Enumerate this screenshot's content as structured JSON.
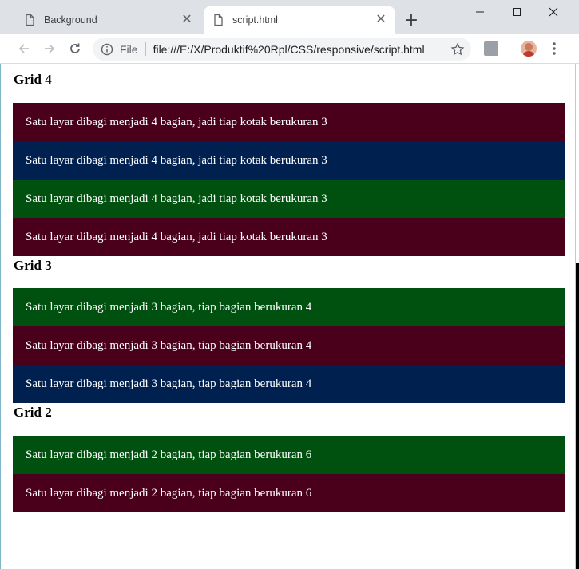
{
  "browser": {
    "tabs": [
      {
        "title": "Background",
        "active": false
      },
      {
        "title": "script.html",
        "active": true
      }
    ],
    "omnibox": {
      "scheme_label": "File",
      "url": "file:///E:/X/Produktif%20Rpl/CSS/responsive/script.html"
    },
    "icons": {
      "back": "arrow-left-icon",
      "forward": "arrow-right-icon",
      "reload": "reload-icon",
      "info": "info-icon",
      "star": "star-icon",
      "menu": "kebab-menu-icon",
      "new_tab": "plus-icon",
      "minimize": "minimize-icon",
      "maximize": "maximize-icon",
      "close": "close-icon"
    }
  },
  "colors": {
    "maroon": "#4a001a",
    "navy": "#002150",
    "green": "#00500f"
  },
  "sections": [
    {
      "heading": "Grid 4",
      "boxes": [
        {
          "text": "Satu layar dibagi menjadi 4 bagian, jadi tiap kotak berukuran 3",
          "color": "#4a001a"
        },
        {
          "text": "Satu layar dibagi menjadi 4 bagian, jadi tiap kotak berukuran 3",
          "color": "#002150"
        },
        {
          "text": "Satu layar dibagi menjadi 4 bagian, jadi tiap kotak berukuran 3",
          "color": "#00500f"
        },
        {
          "text": "Satu layar dibagi menjadi 4 bagian, jadi tiap kotak berukuran 3",
          "color": "#4a001a"
        }
      ]
    },
    {
      "heading": "Grid 3",
      "boxes": [
        {
          "text": "Satu layar dibagi menjadi 3 bagian, tiap bagian berukuran 4",
          "color": "#00500f"
        },
        {
          "text": "Satu layar dibagi menjadi 3 bagian, tiap bagian berukuran 4",
          "color": "#4a001a"
        },
        {
          "text": "Satu layar dibagi menjadi 3 bagian, tiap bagian berukuran 4",
          "color": "#002150"
        }
      ]
    },
    {
      "heading": "Grid 2",
      "boxes": [
        {
          "text": "Satu layar dibagi menjadi 2 bagian, tiap bagian berukuran 6",
          "color": "#00500f"
        },
        {
          "text": "Satu layar dibagi menjadi 2 bagian, tiap bagian berukuran 6",
          "color": "#4a001a"
        }
      ]
    }
  ]
}
